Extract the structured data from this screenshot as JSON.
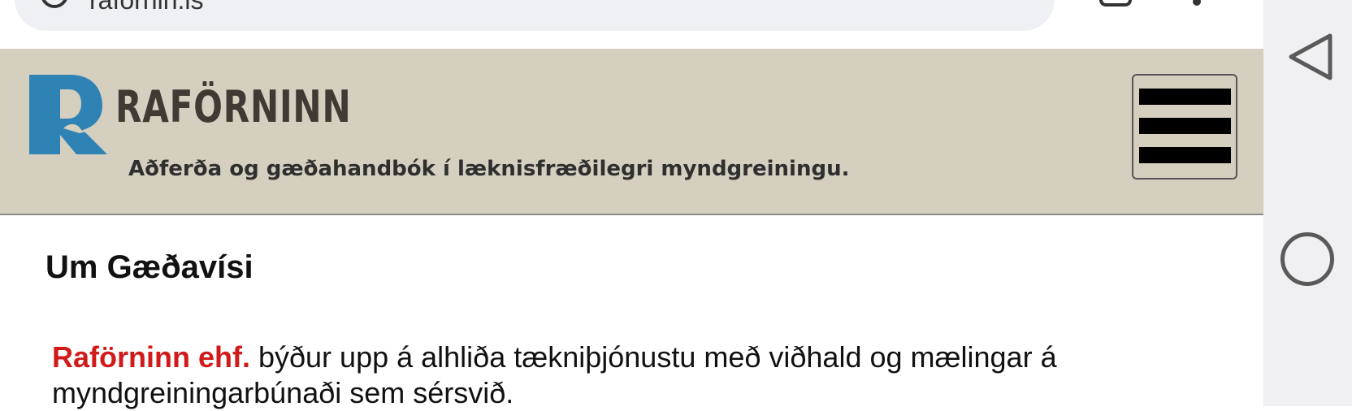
{
  "browser": {
    "url": "rafornin.is"
  },
  "header": {
    "brand_name": "RAFÖRNINN",
    "tagline": "Aðferða og gæðahandbók í læknisfræðilegri myndgreiningu.",
    "logo_letter": "R",
    "brand_color": "#2f82b4"
  },
  "main": {
    "title": "Um Gæðavísi",
    "intro_company": "Raförninn ehf.",
    "intro_text": " býður upp á alhliða tækniþjónustu með viðhald og mælingar á myndgreiningarbúnaði sem sérsvið."
  },
  "navbar": {
    "back_icon": "back-triangle-icon",
    "home_icon": "home-circle-icon"
  }
}
